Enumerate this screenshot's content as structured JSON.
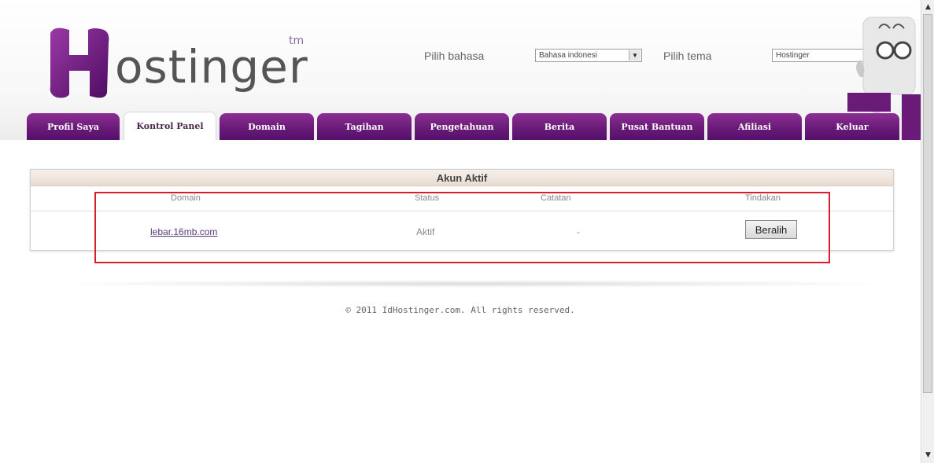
{
  "header": {
    "logo_text": "ostinger",
    "logo_tm": "tm",
    "language_label": "Pilih bahasa",
    "language_value": "Bahasa indonesi",
    "theme_label": "Pilih tema",
    "theme_value": "Hostinger"
  },
  "nav": {
    "tabs": [
      {
        "label": "Profil Saya"
      },
      {
        "label": "Kontrol Panel"
      },
      {
        "label": "Domain"
      },
      {
        "label": "Tagihan"
      },
      {
        "label": "Pengetahuan"
      },
      {
        "label": "Berita"
      },
      {
        "label": "Pusat Bantuan"
      },
      {
        "label": "Afiliasi"
      },
      {
        "label": "Keluar"
      }
    ]
  },
  "panel": {
    "title": "Akun Aktif",
    "columns": [
      "Domain",
      "Status",
      "Catatan",
      "Tindakan"
    ],
    "rows": [
      {
        "domain": "lebar.16mb.com",
        "status": "Aktif",
        "note": "-",
        "action": "Beralih"
      }
    ]
  },
  "footer": {
    "text": "© 2011 IdHostinger.com. All rights reserved."
  },
  "colors": {
    "brand_purple": "#6a1b78",
    "highlight_red": "#d71e2a"
  }
}
